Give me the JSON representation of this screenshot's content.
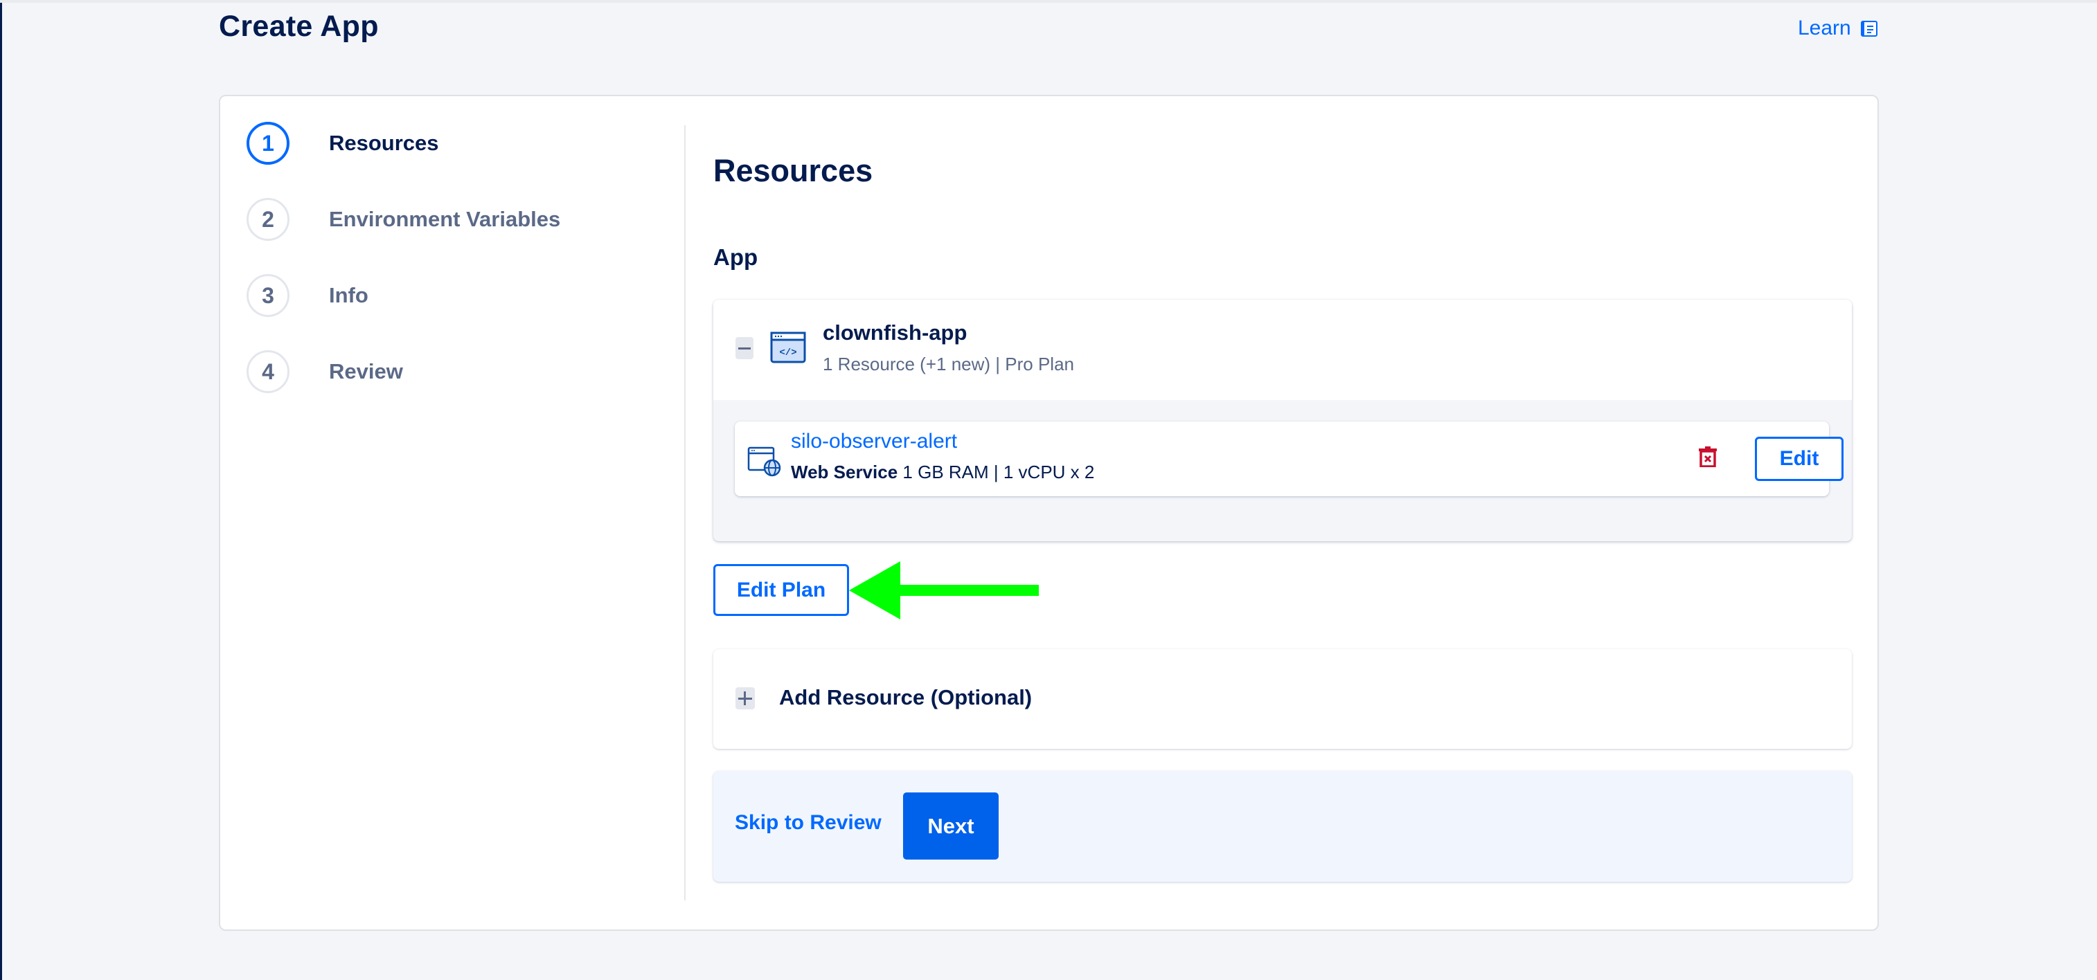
{
  "header": {
    "title": "Create App",
    "learn_label": "Learn",
    "learn_icon": "book-icon"
  },
  "stepper": {
    "steps": [
      {
        "number": "1",
        "label": "Resources",
        "active": true
      },
      {
        "number": "2",
        "label": "Environment Variables",
        "active": false
      },
      {
        "number": "3",
        "label": "Info",
        "active": false
      },
      {
        "number": "4",
        "label": "Review",
        "active": false
      }
    ]
  },
  "main": {
    "section_title": "Resources",
    "sub_title": "App",
    "app": {
      "name": "clownfish-app",
      "meta": "1 Resource (+1 new) | Pro Plan",
      "icon": "code-window-icon",
      "expanded": true,
      "resources": [
        {
          "name": "silo-observer-alert",
          "type": "Web Service",
          "spec": "1 GB RAM | 1 vCPU x 2",
          "icon": "web-service-globe-icon",
          "edit_label": "Edit",
          "delete_icon": "trash-icon"
        }
      ]
    },
    "edit_plan_label": "Edit Plan",
    "annotation": "green-arrow-pointing-left",
    "add_resource_label": "Add Resource (Optional)",
    "footer": {
      "skip_label": "Skip to Review",
      "next_label": "Next"
    }
  },
  "colors": {
    "accent": "#0069ff",
    "primary_button": "#0061eb",
    "text_dark": "#031b4e",
    "text_muted": "#5b6987",
    "danger": "#c8102e",
    "annotation_arrow": "#00ff00",
    "page_bg": "#f3f5f9"
  }
}
